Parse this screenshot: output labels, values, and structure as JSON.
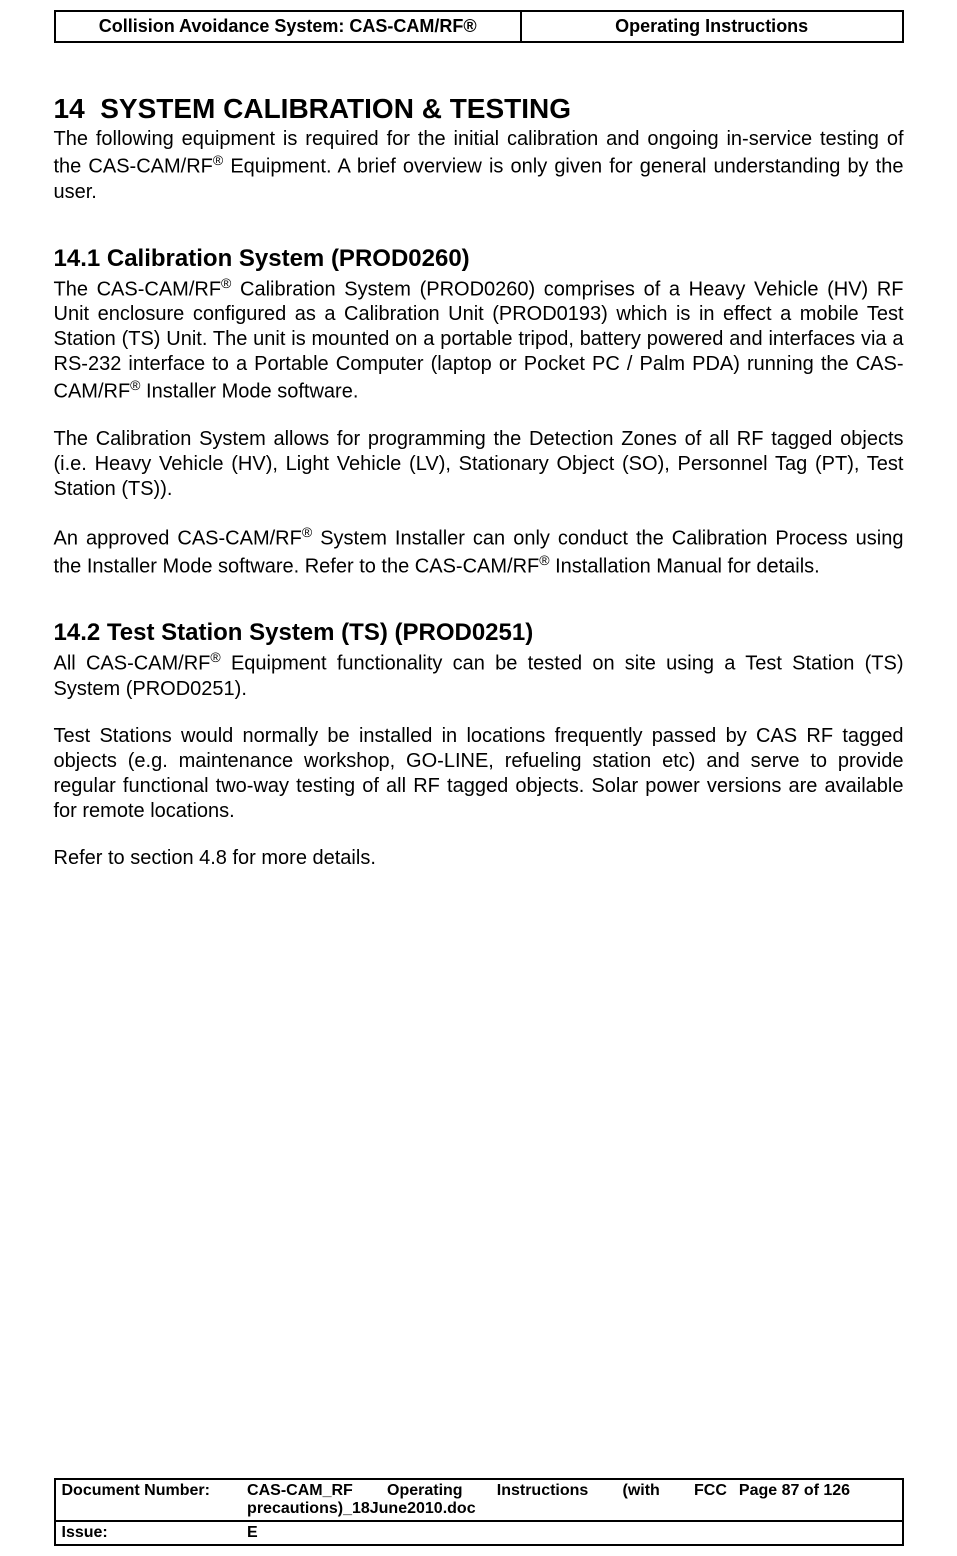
{
  "header": {
    "left": "Collision Avoidance System: CAS-CAM/RF®",
    "right": "Operating Instructions"
  },
  "section": {
    "number": "14",
    "title": "SYSTEM CALIBRATION & TESTING",
    "intro_pre": "The following equipment is required for the initial calibration and ongoing in-service testing of the CAS-CAM/RF",
    "intro_post": " Equipment. A brief overview is only given for general understanding by the user.",
    "sub1": {
      "title": "14.1 Calibration System (PROD0260)",
      "p1_pre": "The CAS-CAM/RF",
      "p1_mid": " Calibration System (PROD0260) comprises of a Heavy Vehicle (HV) RF Unit enclosure configured as a Calibration Unit (PROD0193) which is in effect a mobile Test Station (TS) Unit. The unit is mounted on a portable tripod, battery powered and interfaces via a RS-232 interface to a Portable Computer (laptop or Pocket PC / Palm PDA) running the CAS-CAM/RF",
      "p1_post": " Installer Mode software.",
      "p2": "The Calibration System allows for programming the Detection Zones of all RF tagged objects (i.e. Heavy Vehicle (HV), Light Vehicle (LV), Stationary Object (SO), Personnel Tag (PT), Test Station (TS)).",
      "p3_pre": "An approved CAS-CAM/RF",
      "p3_mid": " System Installer can only conduct the Calibration Process using the Installer Mode software. Refer to the CAS-CAM/RF",
      "p3_post": " Installation Manual for details."
    },
    "sub2": {
      "title": "14.2 Test Station System (TS) (PROD0251)",
      "p1_pre": "All CAS-CAM/RF",
      "p1_post": " Equipment functionality can be tested on site using a Test Station (TS) System (PROD0251).",
      "p2": "Test Stations would normally be installed in locations frequently passed by CAS RF tagged objects (e.g. maintenance workshop, GO-LINE, refueling station etc) and serve to provide regular functional two-way testing of all RF tagged objects. Solar power versions are available for remote locations.",
      "p3": "Refer to section 4.8 for more details."
    }
  },
  "reg": "®",
  "footer": {
    "doc_label": "Document Number:",
    "doc_value": "CAS-CAM_RF Operating Instructions (with FCC precautions)_18June2010.doc",
    "page_label": "Page 87 of  126",
    "issue_label": "Issue:",
    "issue_value": "E"
  }
}
